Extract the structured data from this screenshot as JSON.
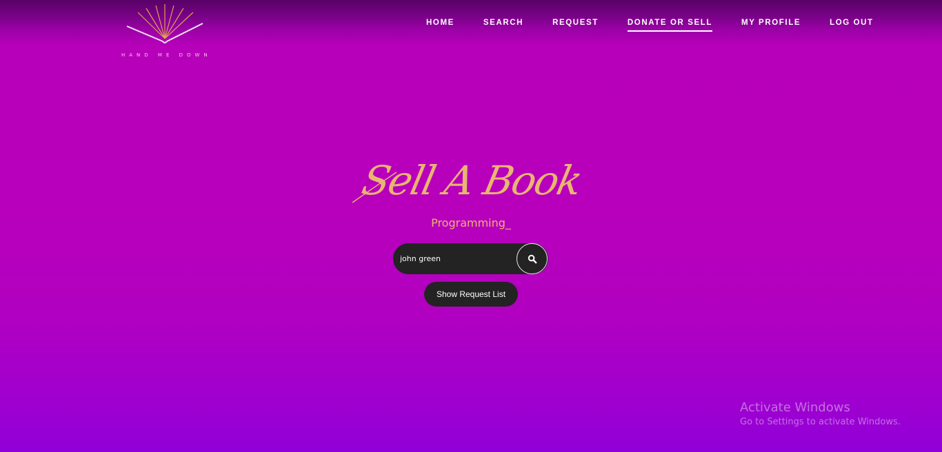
{
  "brand": {
    "name": "HAND ME DOWN",
    "logo_icon": "open-book-sunburst-icon"
  },
  "nav": {
    "items": [
      {
        "label": "HOME"
      },
      {
        "label": "SEARCH"
      },
      {
        "label": "REQUEST"
      },
      {
        "label": "DONATE OR SELL",
        "active": true
      },
      {
        "label": "MY PROFILE"
      },
      {
        "label": "LOG OUT"
      }
    ]
  },
  "hero": {
    "title": "Sell A Book",
    "subtitle": "Programming_"
  },
  "search": {
    "value": "john green",
    "button_icon": "search-icon"
  },
  "actions": {
    "show_request_list": "Show Request List"
  },
  "watermark": {
    "title": "Activate Windows",
    "subtitle": "Go to Settings to activate Windows."
  },
  "colors": {
    "background_top": "#7a0590",
    "background_main": "#b800bc",
    "background_bottom": "#9000d8",
    "accent_gold": "#e9b570",
    "control_dark": "#232323",
    "nav_text": "#ffffff"
  }
}
